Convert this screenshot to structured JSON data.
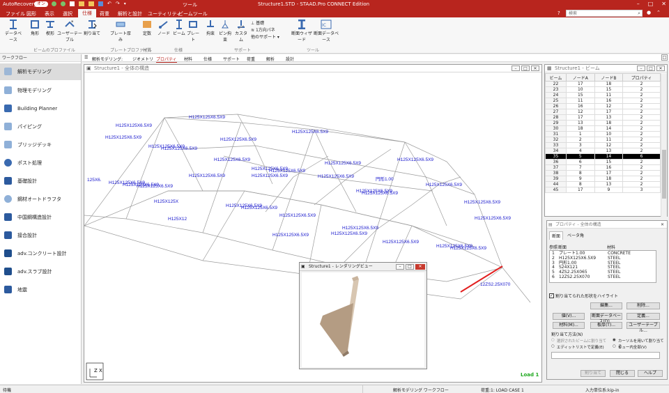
{
  "titlebar": {
    "autorecovery": "AutoRecovery",
    "toggle": "オン",
    "tool_tab": "ツール",
    "title": "Structure1.STD - STAAD.Pro CONNECT Edition"
  },
  "menu": [
    "ファイル",
    "図形",
    "表示",
    "選択",
    "仕様",
    "荷重",
    "解析と設計",
    "ユーティリティ",
    "ビームツール"
  ],
  "search": {
    "placeholder": "検索"
  },
  "ribbon": {
    "buttons": [
      "データベース",
      "角形",
      "楔形",
      "ユーザーテーブル",
      "割り当て",
      "プレート厚み",
      "定数",
      "ノード",
      "ビーム",
      "プレート",
      "拘束",
      "ピン拘束",
      "カスタム",
      "断面ウィザード",
      "断面データベース"
    ],
    "small": [
      "基礎",
      "1方向パネ",
      "他のサポート"
    ],
    "groups": [
      "ビームのプロファイル",
      "プレートプロファイル",
      "材質",
      "仕様",
      "サポート",
      "ツール"
    ]
  },
  "workflow": {
    "title": "ワークフロー",
    "items": [
      "解析モデリング",
      "物理モデリング",
      "Building Planner",
      "パイピング",
      "ブリッジデッキ",
      "ポスト処理",
      "基礎設計",
      "鋼材オートドラフタ",
      "中国鋼構造設計",
      "接合設計",
      "adv.コンクリート設計",
      "adv.スラブ設計",
      "地震"
    ]
  },
  "tabs": {
    "prefix": "解析モデリング:",
    "items": [
      "ジオメトリ",
      "プロパティ",
      "材料",
      "仕様",
      "サポート",
      "荷重",
      "解析",
      "設計"
    ]
  },
  "viewport": {
    "title": "Structure1 - 全体の構造",
    "load_label": "Load 1",
    "labels": [
      "H125X125X6.5X9",
      "H125X125X6.5X9",
      "H125X125X6.5X9",
      "H125X125X6.5X9",
      "H125X125X6.5X9",
      "H125X125X6.5X9",
      "H125X125X6.5X9",
      "H125X125X6.5X9",
      "H125X125X6.5X9",
      "H125X125X6.5X9",
      "H125X125X6.5X9",
      "H125X125X6.5X9",
      "H125X125X6.5X9",
      "H125X125X6.5X9",
      "H125X125X6.5X9",
      "H125X125X6.5X9",
      "H125X125X6.5X9",
      "H125X125X6.5X9",
      "H125X125X6.5X9",
      "H125X125X6.5X9",
      "H125X125X6.5X9",
      "H125X125X6.5X9",
      "H125X125X6.5X9",
      "H125X125X6.5X9",
      "H125X125X6.5X9",
      "H125X125X6.5X9",
      "H125X125X6.5X9",
      "H125X125X6.5X9",
      "H125X125X6.5X9",
      "H125X125X6.5X9",
      "H125X125X6.5X9",
      "H125X125X6.5X9",
      "125X6.",
      "H125X125X",
      "H125X12",
      "円形1.00",
      "12ZS2.25X070"
    ],
    "axis": "Z  X"
  },
  "beam_table": {
    "title": "Structure1 - ビーム",
    "columns": [
      "ビーム",
      "ノードA",
      "ノードB",
      "プロパティ"
    ],
    "rows": [
      [
        "22",
        "17",
        "18",
        "2"
      ],
      [
        "23",
        "10",
        "15",
        "2"
      ],
      [
        "24",
        "15",
        "11",
        "2"
      ],
      [
        "25",
        "11",
        "16",
        "2"
      ],
      [
        "26",
        "16",
        "12",
        "2"
      ],
      [
        "27",
        "12",
        "17",
        "2"
      ],
      [
        "28",
        "17",
        "13",
        "2"
      ],
      [
        "29",
        "13",
        "18",
        "2"
      ],
      [
        "30",
        "18",
        "14",
        "2"
      ],
      [
        "31",
        "1",
        "10",
        "2"
      ],
      [
        "32",
        "2",
        "11",
        "2"
      ],
      [
        "33",
        "3",
        "12",
        "2"
      ],
      [
        "34",
        "4",
        "13",
        "2"
      ],
      [
        "35",
        "5",
        "14",
        "6"
      ],
      [
        "36",
        "6",
        "15",
        "2"
      ],
      [
        "37",
        "7",
        "16",
        "2"
      ],
      [
        "38",
        "8",
        "17",
        "2"
      ],
      [
        "39",
        "9",
        "18",
        "2"
      ],
      [
        "44",
        "8",
        "13",
        "2"
      ],
      [
        "45",
        "17",
        "9",
        "3"
      ]
    ],
    "selected_row": "35"
  },
  "properties": {
    "title": "プロパティ - 全体の構造",
    "tabs": [
      "断面",
      "ベータ角"
    ],
    "columns": [
      "参照",
      "断面",
      "材料"
    ],
    "rows": [
      [
        "1",
        "プレート1.00",
        "CONCRETE"
      ],
      [
        "2",
        "H125X125X6.5X9",
        "STEEL"
      ],
      [
        "3",
        "円形1.00",
        "STEEL"
      ],
      [
        "4",
        "S24X121",
        "STEEL"
      ],
      [
        "5",
        "4ZS2.25X065",
        "STEEL"
      ],
      [
        "6",
        "12ZS2.25X070",
        "STEEL"
      ]
    ],
    "highlight_checkbox": "割り当てられた形状をハイライト",
    "buttons_row1": [
      "編集...",
      "削除..."
    ],
    "buttons_row2": [
      "値(V)...",
      "断面データベース(D)...",
      "定義..."
    ],
    "buttons_row3": [
      "材料(M)...",
      "板厚(T)...",
      "ユーザーテーブル..."
    ],
    "assign_method": "割り当て方法(N)",
    "radio": [
      "選択されたビームに割り当て",
      "カーソルを用いて割り当てる",
      "エディットリストで定義(E)",
      "ビュー内全部(V)"
    ],
    "bottom_buttons": [
      "割り当て",
      "閉じる",
      "ヘルプ"
    ]
  },
  "render_window": {
    "title": "Structure1 - レンダリングビュー"
  },
  "status": {
    "left": "待機",
    "mode": "解析モデリング ワークフロー",
    "load": "荷重:1: LOAD CASE 1",
    "units": "入力単位系:kip-in"
  }
}
